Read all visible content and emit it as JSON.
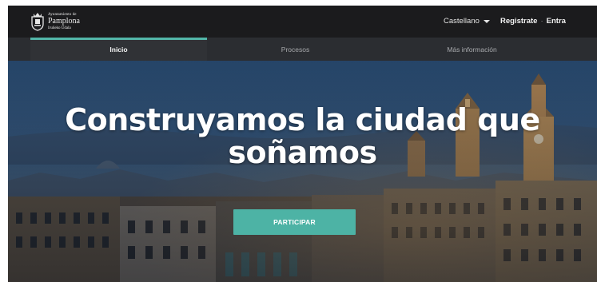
{
  "header": {
    "logo_line1": "Ayuntamiento de",
    "logo_line2": "Pamplona",
    "logo_line3": "Iruñeko Udala",
    "language": "Castellano",
    "register": "Registrate",
    "separator": "·",
    "login": "Entra"
  },
  "nav": {
    "tabs": [
      {
        "label": "Inicio",
        "active": true
      },
      {
        "label": "Procesos",
        "active": false
      },
      {
        "label": "Más información",
        "active": false
      }
    ]
  },
  "hero": {
    "title_line1": "Construyamos la ciudad que",
    "title_line2": "soñamos",
    "cta": "PARTICIPAR"
  },
  "colors": {
    "accent": "#4db3a5",
    "topbar": "#1b1b1d",
    "navbar": "#2b2d31"
  }
}
